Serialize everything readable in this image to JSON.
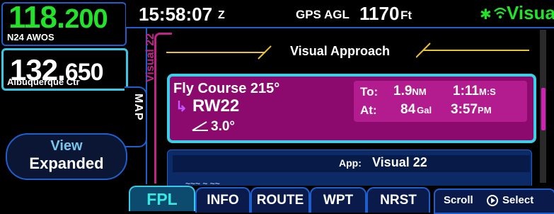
{
  "com": {
    "active_int": "118.",
    "active_dec": "200",
    "active_name": "N24  AWOS",
    "standby_int": "132.",
    "standby_dec": "650",
    "standby_name": "Albuquerque Ctr"
  },
  "view_button": {
    "line1": "View",
    "line2": "Expanded"
  },
  "map_tab": {
    "label": "MAP"
  },
  "topbar": {
    "time": "15:58:07",
    "time_suffix": "Z",
    "gps_label": "GPS AGL",
    "agl_value": "1170",
    "agl_unit": "Ft",
    "status": "Visual",
    "bluetooth_icon": "bluetooth-icon",
    "wifi_icon": "wifi-icon"
  },
  "procedure": {
    "side_label": "Visual 22",
    "title": "Visual Approach"
  },
  "active_leg": {
    "instruction": "Fly Course 215°",
    "waypoint": "RW22",
    "glidepath": "3.0°",
    "to_label": "To:",
    "to_dist": "1.9",
    "to_dist_unit": "NM",
    "to_time": "1:11",
    "to_time_unit": "M:S",
    "at_label": "At:",
    "at_fuel": "84",
    "at_fuel_unit": "Gal",
    "at_time": "3:57",
    "at_time_unit": "PM"
  },
  "next_item": {
    "app_label": "App:",
    "app_value": "Visual 22"
  },
  "tabs": [
    {
      "label": "FPL",
      "active": true
    },
    {
      "label": "INFO",
      "active": false
    },
    {
      "label": "ROUTE",
      "active": false
    },
    {
      "label": "WPT",
      "active": false
    },
    {
      "label": "NRST",
      "active": false
    }
  ],
  "softkey": {
    "scroll": "Scroll",
    "select": "Select"
  },
  "colors": {
    "active_freq": "#22e22a",
    "accent_cyan": "#39c8e6",
    "magenta": "#8c0a6e",
    "border_blue": "#1e5fd0"
  }
}
